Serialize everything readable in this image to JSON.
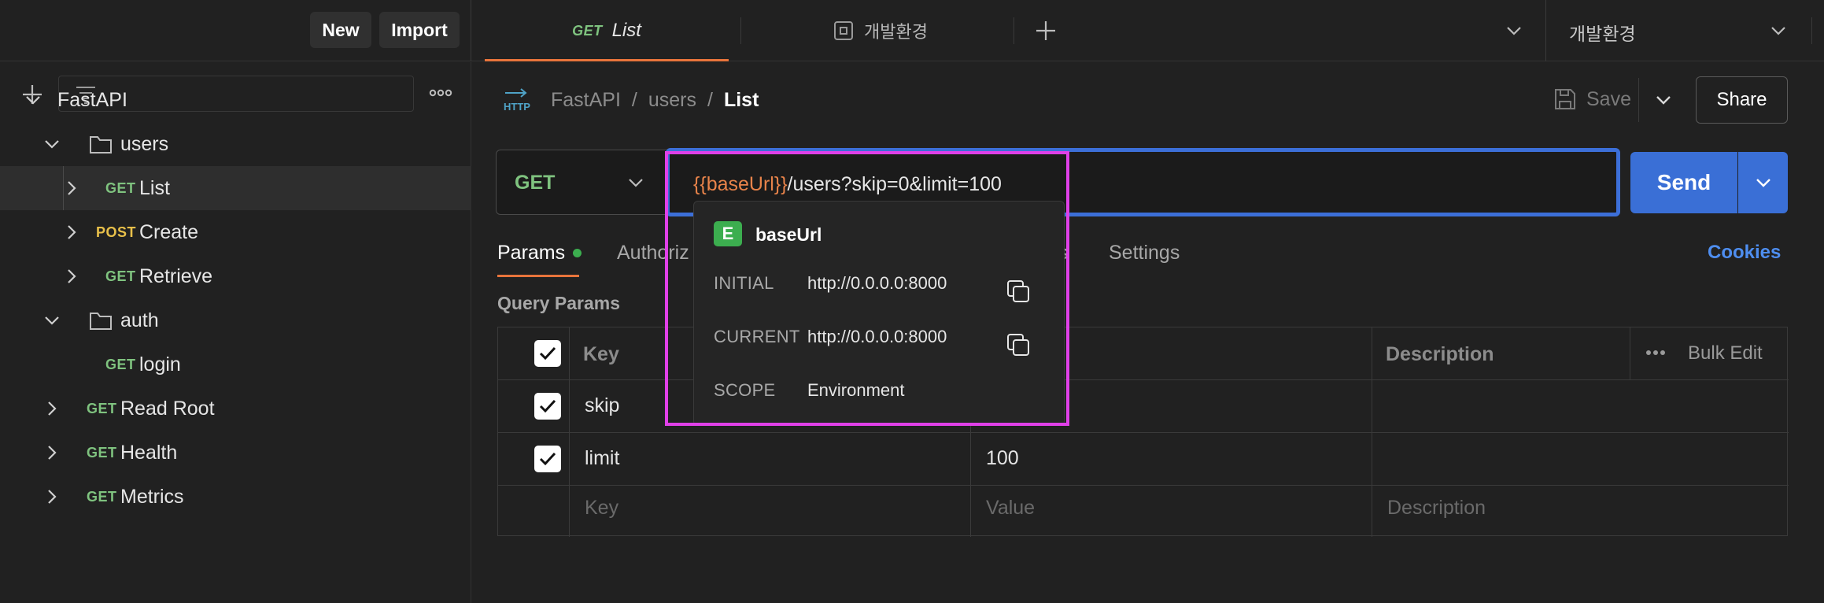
{
  "topbar": {
    "new_label": "New",
    "import_label": "Import",
    "tabs": [
      {
        "method": "GET",
        "label": "List"
      },
      {
        "label": "개발환경"
      }
    ],
    "environment_selected": "개발환경"
  },
  "sidebar": {
    "tree": [
      {
        "label": "FastAPI"
      },
      {
        "label": "users"
      },
      {
        "method": "GET",
        "label": "List"
      },
      {
        "method": "POST",
        "label": "Create"
      },
      {
        "method": "GET",
        "label": "Retrieve"
      },
      {
        "label": "auth"
      },
      {
        "method": "GET",
        "label": "login"
      },
      {
        "method": "GET",
        "label": "Read Root"
      },
      {
        "method": "GET",
        "label": "Health"
      },
      {
        "method": "GET",
        "label": "Metrics"
      }
    ]
  },
  "request": {
    "breadcrumb": [
      "FastAPI",
      "users",
      "List"
    ],
    "save_label": "Save",
    "share_label": "Share",
    "method": "GET",
    "url_var": "{{baseUrl}}",
    "url_rest": "/users?skip=0&limit=100",
    "send_label": "Send",
    "tabs": [
      "Params",
      "Authoriz",
      "s",
      "Settings"
    ],
    "cookies_label": "Cookies",
    "query_params_label": "Query Params",
    "table": {
      "headers": {
        "key": "Key",
        "description": "Description",
        "bulk_edit": "Bulk Edit"
      },
      "rows": [
        {
          "key": "skip",
          "value": ""
        },
        {
          "key": "limit",
          "value": "100"
        }
      ],
      "placeholders": {
        "key": "Key",
        "value": "Value",
        "description": "Description"
      }
    }
  },
  "variable_popup": {
    "badge": "E",
    "name": "baseUrl",
    "initial_label": "INITIAL",
    "initial_value": "http://0.0.0.0:8000",
    "current_label": "CURRENT",
    "current_value": "http://0.0.0.0:8000",
    "scope_label": "SCOPE",
    "scope_value": "Environment"
  },
  "colors": {
    "accent_blue": "#3c6fd8",
    "send_blue": "#3a6fd6",
    "get_green": "#7fc37f",
    "post_yellow": "#e8c04a",
    "var_orange": "#e8834a",
    "highlight_magenta": "#e040e8",
    "env_badge_green": "#3cae4f",
    "active_tab_underline": "#e8743b"
  }
}
